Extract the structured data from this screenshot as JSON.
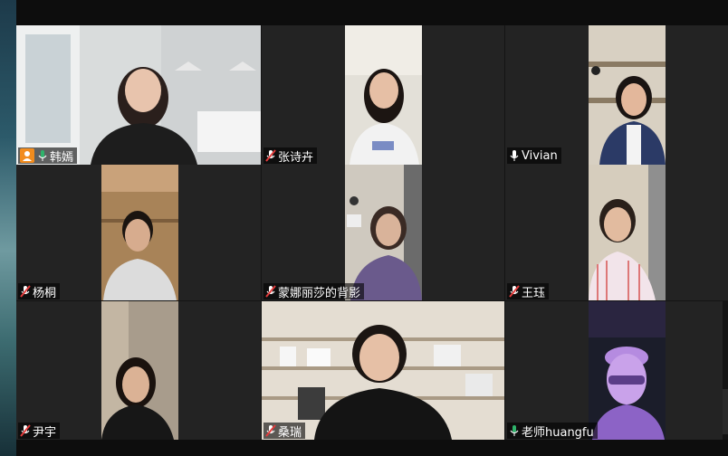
{
  "participants": [
    {
      "name": "韩嫣",
      "mic": "unmuted",
      "role": "host"
    },
    {
      "name": "张诗卉",
      "mic": "muted"
    },
    {
      "name": "Vivian",
      "mic": "unmuted"
    },
    {
      "name": "杨桐",
      "mic": "muted"
    },
    {
      "name": "蒙娜丽莎的背影",
      "mic": "muted"
    },
    {
      "name": "王珏",
      "mic": "muted"
    },
    {
      "name": "尹宇",
      "mic": "muted"
    },
    {
      "name": "桑瑞",
      "mic": "muted"
    },
    {
      "name": "老师huangfu",
      "mic": "unmuted"
    }
  ],
  "colors": {
    "active_speaker_border": "#2fb36b",
    "mic_on": "#2fb36b",
    "mic_muted": "#e23b3b",
    "host_badge": "#f28c1e"
  }
}
